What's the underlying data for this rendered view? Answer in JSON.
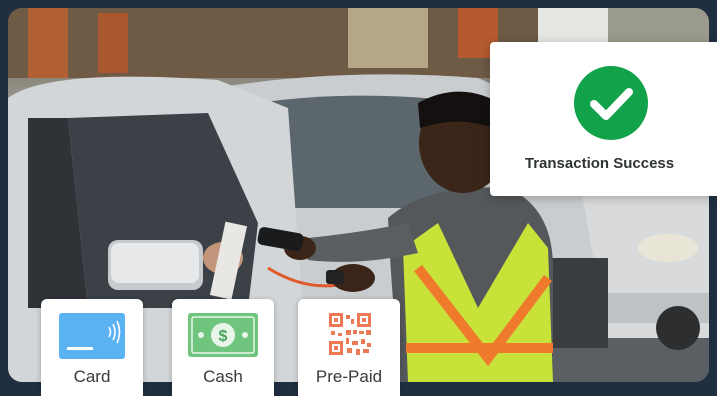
{
  "colors": {
    "background": "#1f2f40",
    "success_green": "#12a34a",
    "card_blue": "#5ab2f2",
    "cash_green": "#6fc47e",
    "qr_orange": "#ee7a55"
  },
  "photo": {
    "description_icon": "attendant-photo"
  },
  "status_card": {
    "icon": "check-circle-icon",
    "message": "Transaction Success"
  },
  "payment_options": [
    {
      "label": "Card",
      "icon": "credit-card-icon"
    },
    {
      "label": "Cash",
      "icon": "cash-bill-icon"
    },
    {
      "label": "Pre-Paid",
      "icon": "qr-code-icon"
    }
  ]
}
